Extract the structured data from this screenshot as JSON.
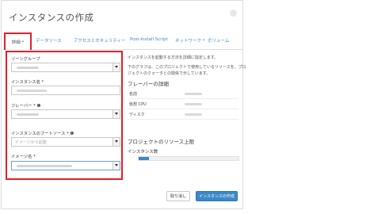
{
  "modal": {
    "title": "インスタンスの作成"
  },
  "tabs": [
    {
      "label": "詳細 *",
      "active": true
    },
    {
      "label": "データソース"
    },
    {
      "label": "アクセスとセキュリティー"
    },
    {
      "label": "Post-Install Script"
    },
    {
      "label": "ネットワーク *"
    },
    {
      "label": "ボリューム"
    }
  ],
  "form": {
    "zone_group_label": "ゾーングループ",
    "instance_name_label": "インスタンス名 *",
    "flavor_label": "フレーバー * ❶",
    "boot_source_label": "インスタンスのブートソース * ❶",
    "boot_source_value": "イメージから起動",
    "image_label": "イメージ名 *"
  },
  "side": {
    "desc_line1": "インスタンスを起動する方法を詳細に指定します。",
    "desc_line2": "下のグラフは、このプロジェクトで使用しているリソースを、プロ",
    "desc_line3": "ジェクトのクォータとの関係で示しています。",
    "flavor_heading": "フレーバーの詳細",
    "flavor_rows": [
      {
        "key": "名前"
      },
      {
        "key": "仮想 CPU"
      },
      {
        "key": "ディスク"
      }
    ],
    "quota_heading": "プロジェクトのリソース上限",
    "quota_item_label": "インスタンス数",
    "quota_fraction": 0.1
  },
  "footer": {
    "cancel_label": "取り消し",
    "create_label": "インスタンスの作成"
  },
  "colors": {
    "accent": "#3b87c8",
    "highlight": "#e0202e"
  }
}
